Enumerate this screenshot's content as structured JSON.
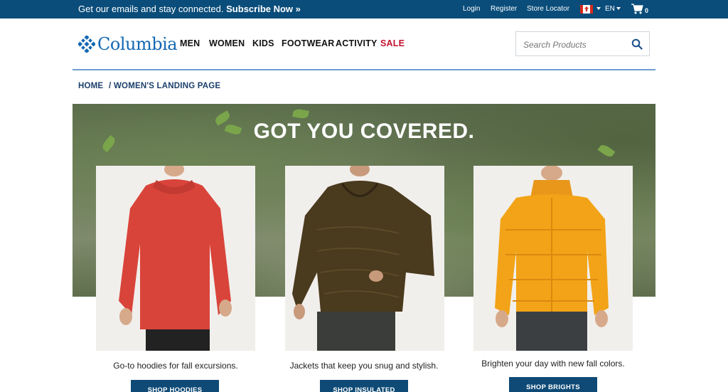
{
  "topbar": {
    "promo_text": "Get our emails and stay connected.",
    "promo_link": "Subscribe Now »",
    "login": "Login",
    "register": "Register",
    "store_locator": "Store Locator",
    "language": "EN",
    "cart_count": "0"
  },
  "header": {
    "logo_text": "Columbia",
    "nav": [
      "MEN",
      "WOMEN",
      "KIDS",
      "FOOTWEAR",
      "ACTIVITY",
      "SALE"
    ],
    "search_placeholder": "Search Products"
  },
  "breadcrumb": {
    "home": "HOME",
    "separator": "/",
    "current": "WOMEN'S LANDING PAGE"
  },
  "hero": {
    "title": "GOT YOU COVERED."
  },
  "products": [
    {
      "description": "Go-to hoodies for fall excursions.",
      "button": "SHOP HOODIES",
      "color": "#d9443a"
    },
    {
      "description": "Jackets that keep you snug and stylish.",
      "button": "SHOP INSULATED",
      "color": "#4a3a1e"
    },
    {
      "description": "Brighten your day with new fall colors.",
      "button": "SHOP BRIGHTS",
      "color": "#f2a317"
    }
  ],
  "colors": {
    "topbar": "#0a4d7a",
    "brand_blue": "#1368b3",
    "sale_red": "#c4122f",
    "button": "#0e4a75"
  }
}
